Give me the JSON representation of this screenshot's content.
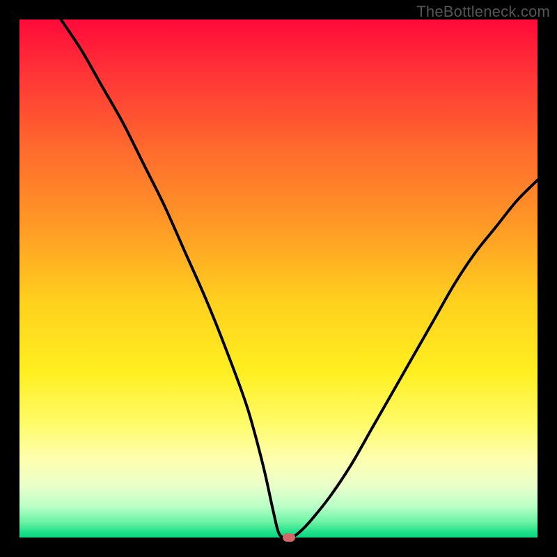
{
  "watermark": "TheBottleneck.com",
  "chart_data": {
    "type": "line",
    "title": "",
    "xlabel": "",
    "ylabel": "",
    "xlim": [
      0,
      100
    ],
    "ylim": [
      0,
      100
    ],
    "grid": false,
    "legend": false,
    "series": [
      {
        "name": "curve",
        "x": [
          8,
          12,
          16,
          20,
          24,
          28,
          32,
          36,
          40,
          44,
          47,
          49,
          50,
          51,
          52.5,
          54,
          56,
          60,
          64,
          68,
          72,
          76,
          80,
          84,
          88,
          92,
          96,
          100
        ],
        "values": [
          100,
          94,
          87,
          80,
          72,
          64,
          55,
          46,
          36,
          25,
          14,
          5,
          1,
          0,
          0,
          1,
          3,
          8,
          14,
          21,
          28,
          35,
          42,
          49,
          55,
          60,
          65,
          69
        ]
      }
    ],
    "marker": {
      "x": 52,
      "y": 0,
      "color": "#d36868"
    },
    "background_gradient": {
      "top": "#ff0a3a",
      "mid": "#ffef20",
      "bottom": "#0bd680"
    }
  }
}
